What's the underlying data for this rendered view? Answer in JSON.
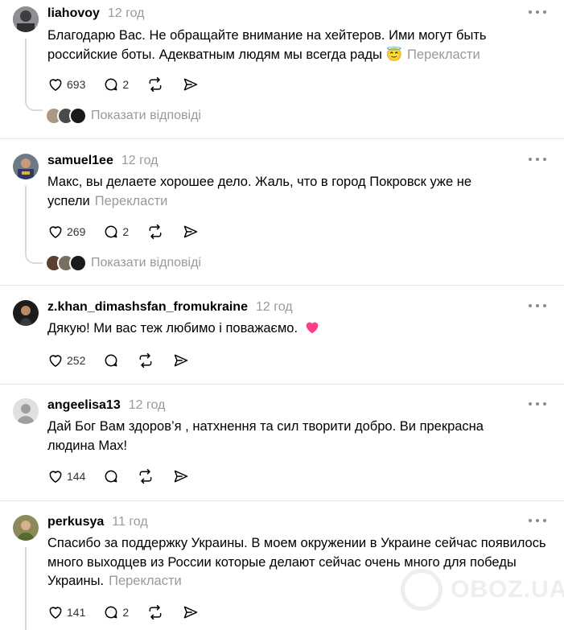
{
  "posts": [
    {
      "username": "liahovoy",
      "time": "12 год",
      "text": "Благодарю Вас. Не обращайте внимание на хейтеров. Ими могут быть российские боты. Адекватным людям мы всегда рады",
      "emoji": "😇",
      "translate": "Перекласти",
      "likes": "693",
      "replies_count": "2",
      "show_replies": "Показати відповіді"
    },
    {
      "username": "samuel1ee",
      "time": "12 год",
      "text": "Макс, вы делаете хорошее дело. Жаль, что в город Покровск уже не успели",
      "translate": "Перекласти",
      "likes": "269",
      "replies_count": "2",
      "show_replies": "Показати відповіді"
    },
    {
      "username": "z.khan_dimashsfan_fromukraine",
      "time": "12 год",
      "text": "Дякую! Ми вас теж любимо і поважаємо.",
      "emoji": "💗",
      "likes": "252"
    },
    {
      "username": "angeelisa13",
      "time": "12 год",
      "text": "Дай Бог Вам здоров’я , натхнення та сил творити добро. Ви прекрасна людина Max!",
      "likes": "144"
    },
    {
      "username": "perkusya",
      "time": "11 год",
      "text": "Спасибо за поддержку Украины. В моем окружении в Украине сейчас появилось много выходцев из России которые делают сейчас очень много для победы Украины.",
      "translate": "Перекласти",
      "likes": "141",
      "replies_count": "2"
    }
  ],
  "watermark": "OBOZ.UA",
  "colors": {
    "muted": "#999999",
    "divider": "#e5e5e5",
    "heart_emoji": "#ff3d8b"
  },
  "icons": [
    "heart-icon",
    "comment-icon",
    "repost-icon",
    "share-icon",
    "more-icon"
  ]
}
